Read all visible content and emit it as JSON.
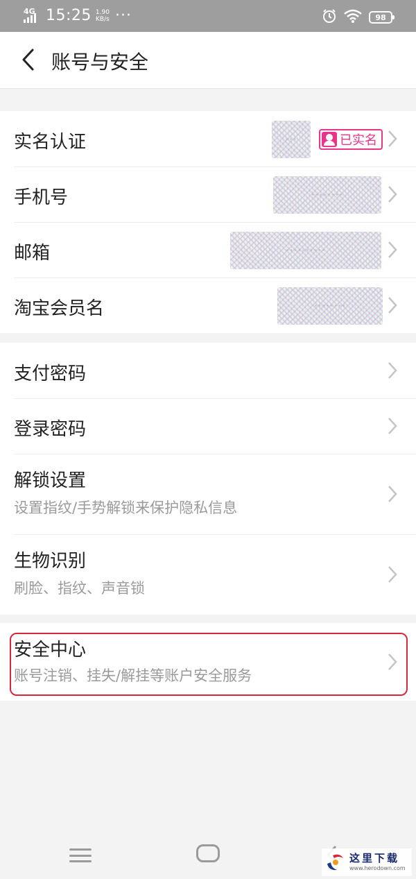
{
  "status_bar": {
    "network": "4G",
    "time": "15:25",
    "speed_value": "1.90",
    "speed_unit": "KB/s",
    "more": "···",
    "battery": "98",
    "icons": [
      "signal-icon",
      "alarm-icon",
      "wifi-icon",
      "battery-icon"
    ]
  },
  "header": {
    "title": "账号与安全",
    "back_icon": "chevron-left-icon"
  },
  "sections": {
    "identity": {
      "realname": {
        "label": "实名认证",
        "value_masked": "···",
        "badge": "已实名"
      },
      "phone": {
        "label": "手机号",
        "value_masked": "········"
      },
      "email": {
        "label": "邮箱",
        "value_masked": "··········"
      },
      "taobao": {
        "label": "淘宝会员名",
        "value_masked": "········"
      }
    },
    "security": {
      "pay_password": {
        "label": "支付密码"
      },
      "login_password": {
        "label": "登录密码"
      },
      "unlock": {
        "label": "解锁设置",
        "sub": "设置指纹/手势解锁来保护隐私信息"
      },
      "biometric": {
        "label": "生物识别",
        "sub": "刷脸、指纹、声音锁"
      }
    },
    "center": {
      "security_center": {
        "label": "安全中心",
        "sub": "账号注销、挂失/解挂等账户安全服务"
      }
    }
  },
  "watermark": {
    "text": "这里下载",
    "sub": "www.herodown.com"
  },
  "colors": {
    "status_bar": "#9e9e9e",
    "badge": "#e8358a",
    "highlight": "#d9273a",
    "background": "#f3f3f3"
  }
}
